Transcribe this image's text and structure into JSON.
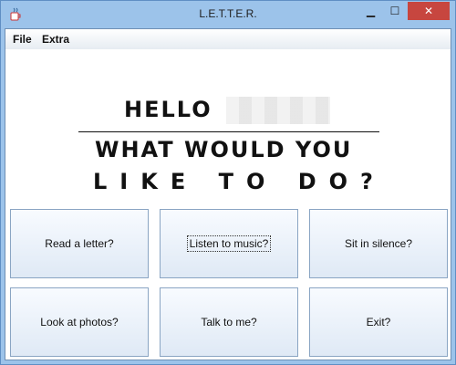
{
  "window": {
    "title": "L.E.T.T.E.R."
  },
  "menubar": {
    "items": [
      {
        "label": "File"
      },
      {
        "label": "Extra"
      }
    ]
  },
  "header": {
    "hello": "HELLO",
    "line1": "WHAT WOULD YOU",
    "line2": "LIKE TO DO?"
  },
  "buttons": [
    {
      "label": "Read a letter?"
    },
    {
      "label": "Listen to music?"
    },
    {
      "label": "Sit in silence?"
    },
    {
      "label": "Look at photos?"
    },
    {
      "label": "Talk to me?"
    },
    {
      "label": "Exit?"
    }
  ],
  "icons": {
    "app": "java-cup-icon",
    "minimize": "minimize-icon",
    "maximize": "maximize-icon",
    "close": "close-icon"
  }
}
